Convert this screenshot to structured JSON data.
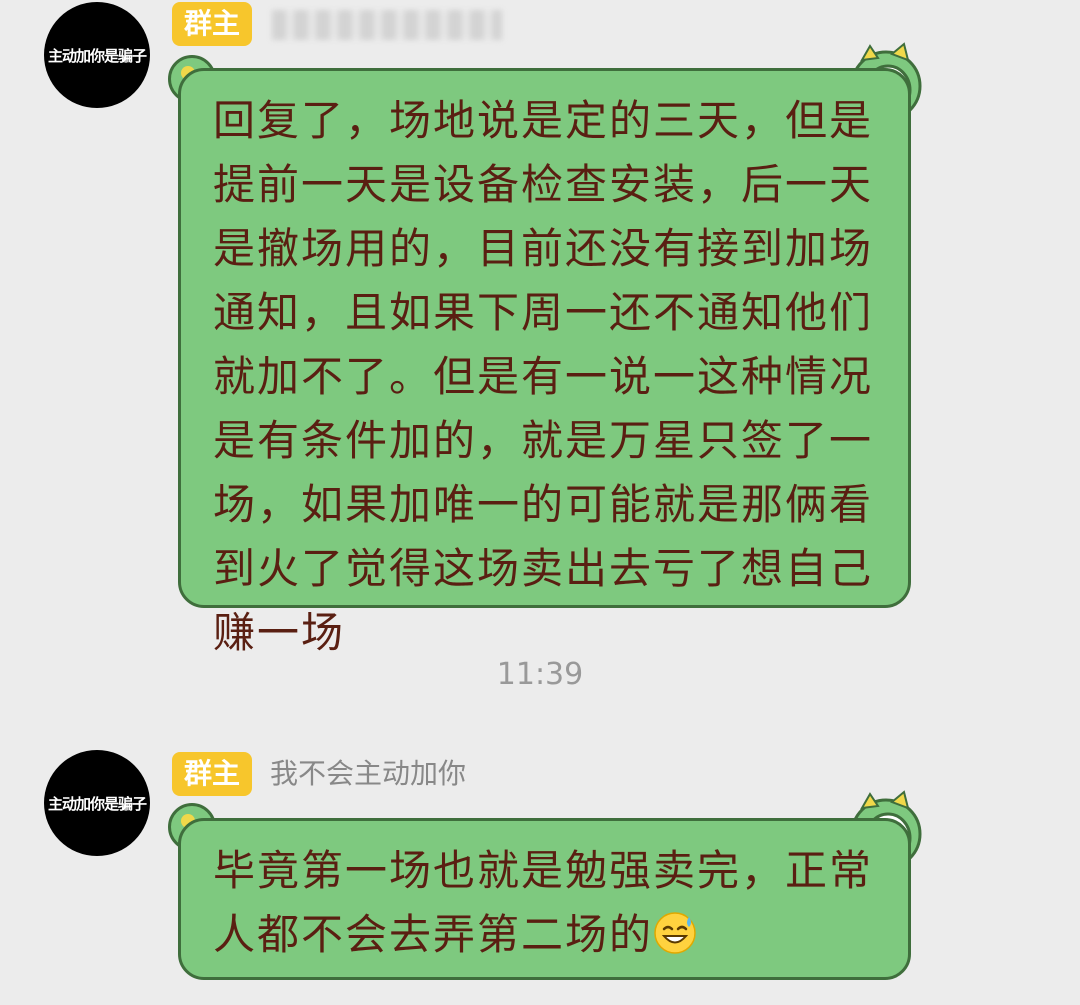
{
  "messages": [
    {
      "avatar_text": "主动加你是骗子",
      "role_badge": "群主",
      "sender_name": "",
      "text": "回复了，场地说是定的三天，但是提前一天是设备检查安装，后一天是撤场用的，目前还没有接到加场通知，且如果下周一还不通知他们就加不了。但是有一说一这种情况是有条件加的，就是万星只签了一场，如果加唯一的可能就是那俩看到火了觉得这场卖出去亏了想自己赚一场"
    },
    {
      "avatar_text": "主动加你是骗子",
      "role_badge": "群主",
      "sender_name": "我不会主动加你",
      "text": "毕竟第一场也就是勉强卖完，正常人都不会去弄第二场的",
      "trailing_emoji": "sweat-smile-emoji"
    }
  ],
  "timestamp": "11:39",
  "colors": {
    "bubble": "#7ec97f",
    "bubble_border": "#3f6e3c",
    "bubble_text": "#5a1f12",
    "badge": "#f7c62c",
    "background": "#ececec"
  }
}
